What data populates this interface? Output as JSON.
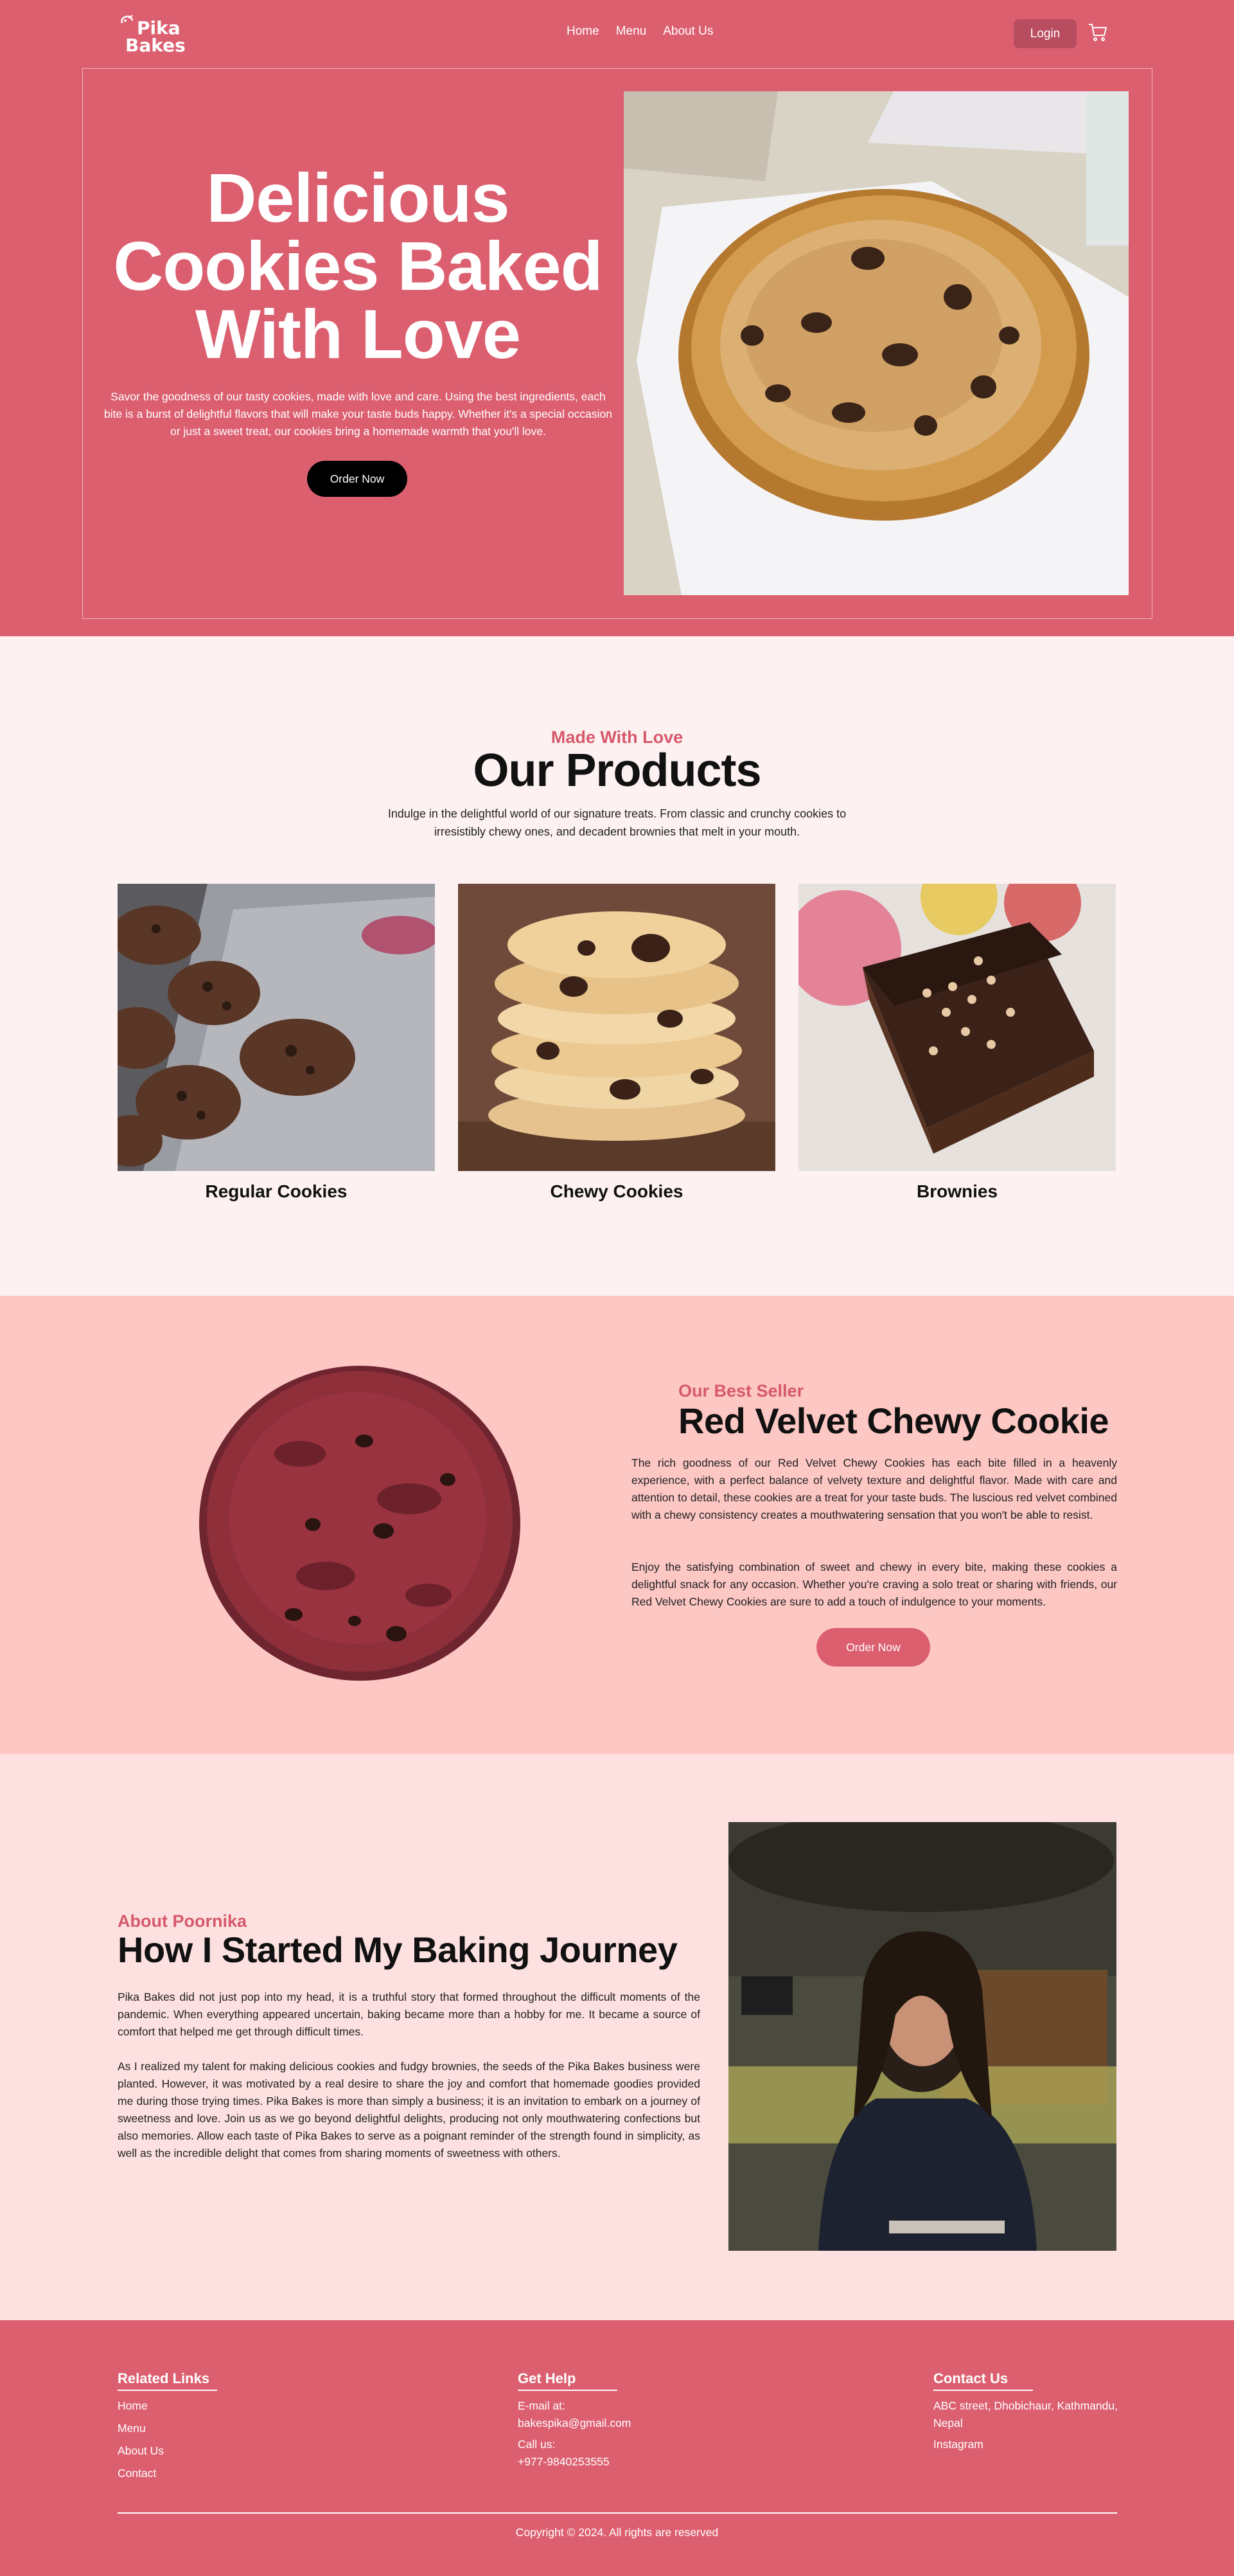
{
  "brand": {
    "name_line1": "Pika",
    "name_line2": "Bakes",
    "color": "#dc5f70"
  },
  "nav": {
    "links": [
      "Home",
      "Menu",
      "About Us"
    ],
    "login_label": "Login",
    "cart_icon": "cart-icon"
  },
  "hero": {
    "title": "Delicious Cookies Baked With Love",
    "description": "Savor the goodness of our tasty cookies, made with love and care. Using the best ingredients, each bite is a burst of delightful flavors that will make your taste buds happy. Whether it's a special occasion or just a sweet treat, our cookies bring a homemade warmth that you'll love.",
    "cta": "Order Now"
  },
  "products": {
    "eyebrow": "Made With Love",
    "title": "Our Products",
    "description": "Indulge in the delightful world of our signature treats. From classic and crunchy cookies to irresistibly chewy ones, and decadent brownies that melt in your mouth.",
    "items": [
      {
        "name": "Regular Cookies"
      },
      {
        "name": "Chewy Cookies"
      },
      {
        "name": "Brownies"
      }
    ]
  },
  "best_seller": {
    "eyebrow": "Our Best Seller",
    "title": "Red Velvet Chewy Cookie",
    "paragraphs": [
      "The rich goodness of our Red Velvet Chewy Cookies has each bite filled in a heavenly experience, with a perfect balance of velvety texture and delightful flavor. Made with care and attention to detail, these cookies are a treat for your taste buds. The luscious red velvet combined with a chewy consistency creates a mouthwatering sensation that you won't be able to resist.",
      "Enjoy the satisfying combination of sweet and chewy in every bite, making these cookies a delightful snack for any occasion. Whether you're craving a solo treat or sharing with friends, our Red Velvet Chewy Cookies are sure to add a touch of indulgence to your moments."
    ],
    "cta": "Order Now"
  },
  "about": {
    "eyebrow": "About Poornika",
    "title": "How I Started My Baking Journey",
    "paragraphs": [
      "Pika Bakes did not just pop into my head, it is a truthful story that formed throughout the difficult moments of the pandemic. When everything appeared uncertain, baking became more than a hobby for me. It became a source of comfort that helped me get through difficult times.",
      "As I realized my talent for making delicious cookies and fudgy brownies, the seeds of the Pika Bakes business were planted. However, it was motivated by a real desire to share the joy and comfort that homemade goodies provided me during those trying times. Pika Bakes is more than simply a business; it is an invitation to embark on a journey of sweetness and love. Join us as we go beyond delightful delights, producing not only mouthwatering confections but also memories. Allow each taste of Pika Bakes to serve as a poignant reminder of the strength found in simplicity, as well as the incredible delight that comes from sharing moments of sweetness with others."
    ]
  },
  "footer": {
    "related": {
      "title": "Related Links",
      "links": [
        "Home",
        "Menu",
        "About Us",
        "Contact"
      ]
    },
    "help": {
      "title": "Get Help",
      "email_label": "E-mail at:",
      "email": "bakespika@gmail.com",
      "call_label": "Call us:",
      "phone": "+977-9840253555"
    },
    "contact": {
      "title": "Contact Us",
      "address": "ABC street, Dhobichaur, Kathmandu, Nepal",
      "instagram": "Instagram"
    },
    "copyright": "Copyright © 2024. All rights are reserved"
  }
}
